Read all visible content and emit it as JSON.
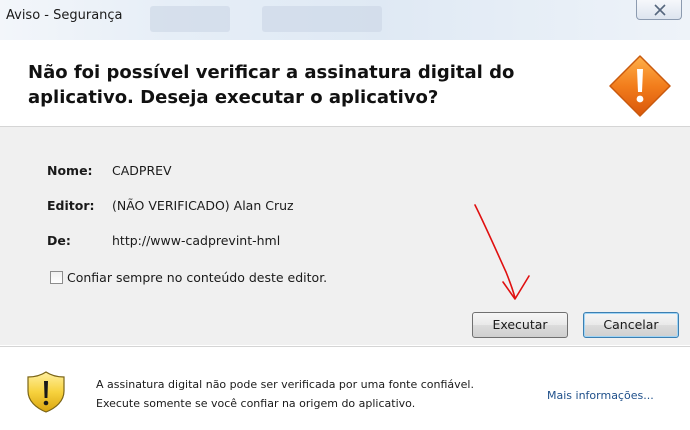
{
  "window": {
    "title": "Aviso - Segurança",
    "close_label": "✕"
  },
  "header": {
    "headline": "Não foi possível verificar a assinatura digital do aplicativo.  Deseja executar o aplicativo?"
  },
  "details": {
    "name_label": "Nome:",
    "name_value": "CADPREV",
    "publisher_label": "Editor:",
    "publisher_value": "(NÃO VERIFICADO) Alan Cruz",
    "from_label": "De:",
    "from_value": "http://www-cadprevint-hml"
  },
  "trust_checkbox": {
    "label": "Confiar sempre no conteúdo deste editor.",
    "checked": false
  },
  "buttons": {
    "run_label": "Executar",
    "cancel_label": "Cancelar"
  },
  "footer": {
    "warning_line1": "A assinatura digital não pode ser verificada por uma fonte confiável.",
    "warning_line2": "Execute somente se você confiar na origem do aplicativo.",
    "more_info_label": "Mais informações..."
  },
  "colors": {
    "warning_orange": "#f07a1a",
    "shield_yellow": "#f7d23e",
    "annotation_red": "#e01010",
    "link_blue": "#1e4f8a"
  },
  "icons": {
    "header_icon": "warning-diamond-icon",
    "footer_icon": "warning-shield-icon",
    "annotation": "red-arrow-annotation"
  }
}
